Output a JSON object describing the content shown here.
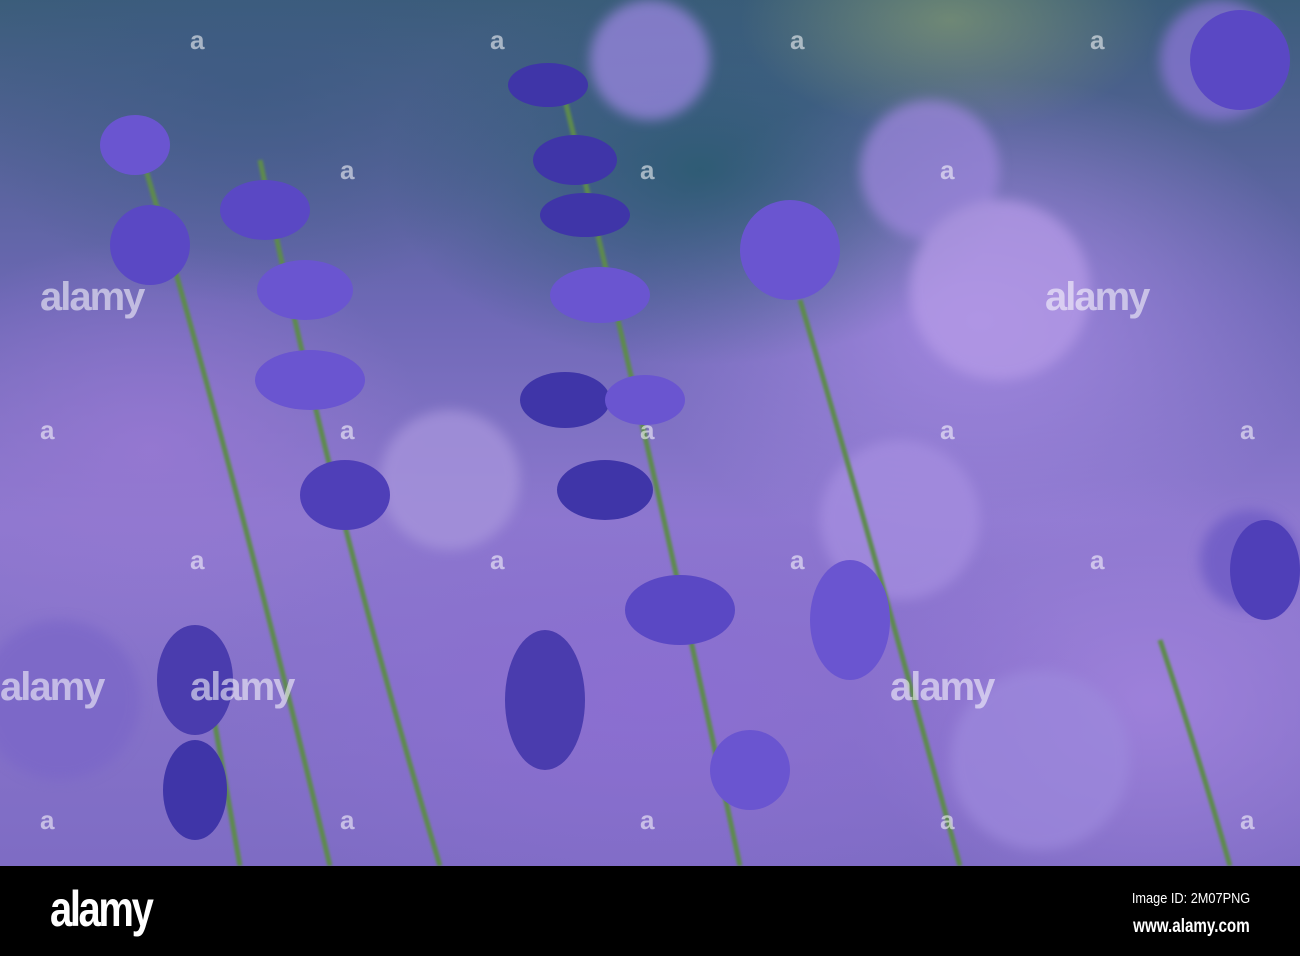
{
  "photo": {
    "subject": "lavender",
    "colors": {
      "sky": "#3b5d7a",
      "lavender": "#7e6cc4",
      "flower_dark": "#3a2f9a",
      "stem": "#5d8a4e"
    },
    "watermark": "alamy"
  },
  "footer": {
    "logo": "alamy",
    "image_id": "Image ID: 2M07PNG",
    "website": "www.alamy.com"
  }
}
